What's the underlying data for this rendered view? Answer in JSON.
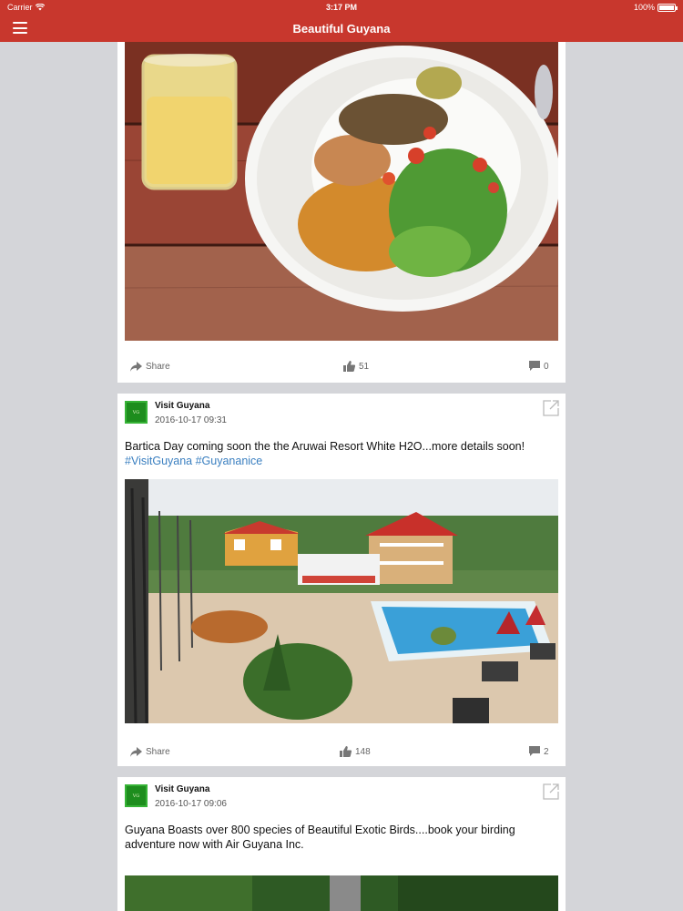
{
  "status_bar": {
    "carrier": "Carrier",
    "time": "3:17 PM",
    "battery": "100%"
  },
  "nav": {
    "title": "Beautiful Guyana"
  },
  "posts": [
    {
      "share_label": "Share",
      "likes": "51",
      "comments": "0"
    },
    {
      "page_name": "Visit Guyana",
      "timestamp": "2016-10-17 09:31",
      "text": "Bartica Day coming soon the the Aruwai Resort White H2O...more details soon!",
      "hashtags": "#VisitGuyana #Guyananice",
      "share_label": "Share",
      "likes": "148",
      "comments": "2"
    },
    {
      "page_name": "Visit Guyana",
      "timestamp": "2016-10-17 09:06",
      "text": "Guyana Boasts over 800 species of Beautiful Exotic Birds....book your birding adventure now with Air Guyana Inc."
    }
  ],
  "colors": {
    "brand": "#c8372d",
    "link": "#3a7fc0",
    "background": "#d4d5d9"
  },
  "icons": [
    "menu-icon",
    "wifi-icon",
    "share-icon",
    "thumbs-up-icon",
    "comment-icon",
    "open-external-icon"
  ]
}
